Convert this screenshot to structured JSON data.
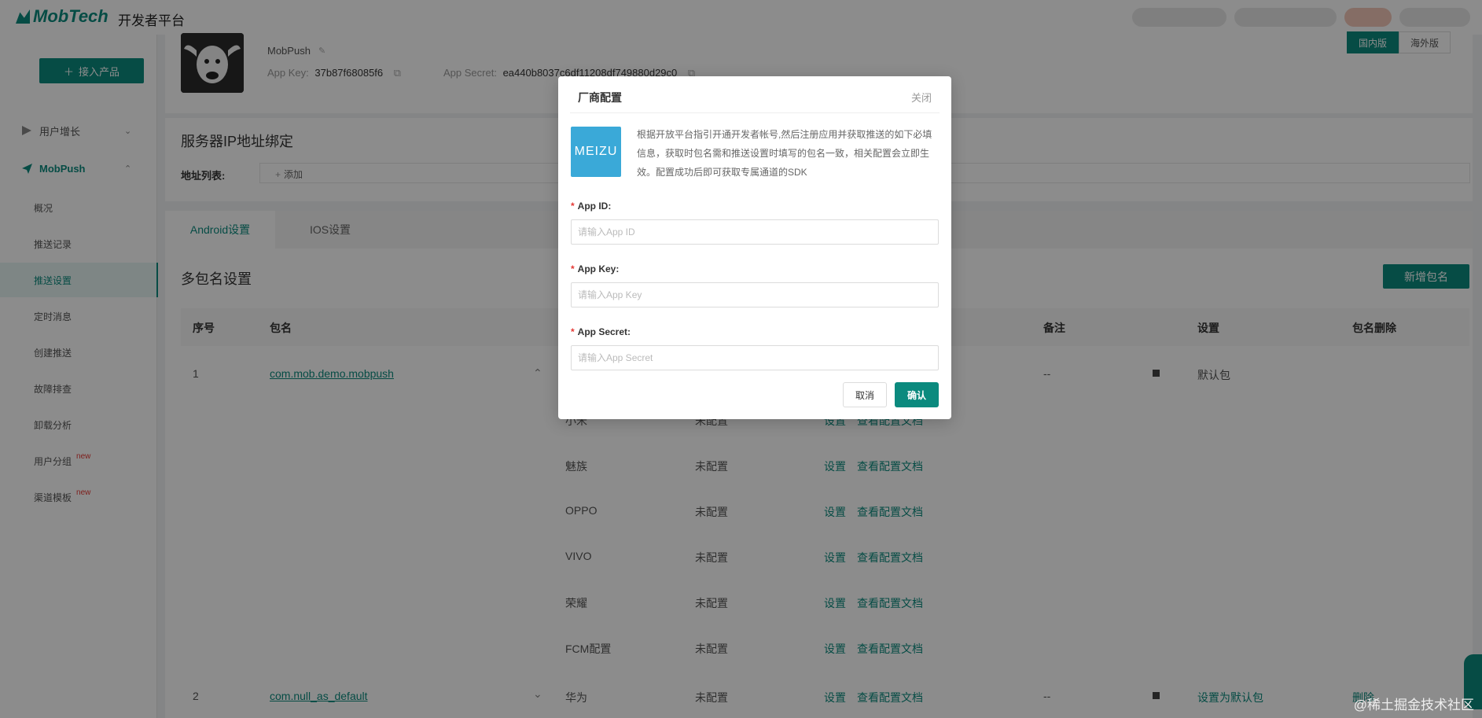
{
  "header": {
    "brand": "MobTech",
    "platform_name": "开发者平台"
  },
  "sidebar": {
    "access_button": "接入产品",
    "groups": [
      {
        "label": "用户增长"
      },
      {
        "label": "MobPush"
      }
    ],
    "items": [
      {
        "label": "概况"
      },
      {
        "label": "推送记录"
      },
      {
        "label": "推送设置"
      },
      {
        "label": "定时消息"
      },
      {
        "label": "创建推送"
      },
      {
        "label": "故障排查"
      },
      {
        "label": "卸载分析"
      },
      {
        "label": "用户分组",
        "badge": "new"
      },
      {
        "label": "渠道模板",
        "badge": "new"
      }
    ]
  },
  "app": {
    "name": "MobPush",
    "key_label": "App Key:",
    "key_value": "37b87f68085f6",
    "secret_label": "App Secret:",
    "secret_value": "ea440b8037c6df11208df749880d29c0"
  },
  "region_switch": {
    "domestic": "国内版",
    "overseas": "海外版"
  },
  "ip_binding": {
    "title": "服务器IP地址绑定",
    "list_label": "地址列表:",
    "add_label": "添加"
  },
  "tabs": [
    {
      "label": "Android设置"
    },
    {
      "label": "IOS设置"
    }
  ],
  "packages": {
    "title": "多包名设置",
    "add_button": "新增包名",
    "columns": {
      "index": "序号",
      "package": "包名",
      "note": "备注",
      "settings": "设置",
      "delete": "包名删除"
    },
    "rows": [
      {
        "index": "1",
        "package": "com.mob.demo.mobpush",
        "note": "--",
        "settings": "默认包",
        "delete": ""
      },
      {
        "index": "2",
        "package": "com.null_as_default",
        "note": "--",
        "settings": "设置为默认包",
        "delete": "删除"
      }
    ],
    "vendors": [
      {
        "name": "小米",
        "status": "未配置",
        "set": "设置",
        "doc": "查看配置文档"
      },
      {
        "name": "魅族",
        "status": "未配置",
        "set": "设置",
        "doc": "查看配置文档"
      },
      {
        "name": "OPPO",
        "status": "未配置",
        "set": "设置",
        "doc": "查看配置文档"
      },
      {
        "name": "VIVO",
        "status": "未配置",
        "set": "设置",
        "doc": "查看配置文档"
      },
      {
        "name": "荣耀",
        "status": "未配置",
        "set": "设置",
        "doc": "查看配置文档"
      },
      {
        "name": "FCM配置",
        "status": "未配置",
        "set": "设置",
        "doc": "查看配置文档"
      },
      {
        "name": "华为",
        "status": "未配置",
        "set": "设置",
        "doc": "查看配置文档"
      }
    ]
  },
  "modal": {
    "title": "厂商配置",
    "close": "关闭",
    "logo_text": "MEIZU",
    "description": "根据开放平台指引开通开发者帐号,然后注册应用并获取推送的如下必填信息，获取时包名需和推送设置时填写的包名一致，相关配置会立即生效。配置成功后即可获取专属通道的SDK",
    "fields": [
      {
        "label": "App ID:",
        "placeholder": "请输入App ID",
        "value": ""
      },
      {
        "label": "App Key:",
        "placeholder": "请输入App Key",
        "value": ""
      },
      {
        "label": "App Secret:",
        "placeholder": "请输入App Secret",
        "value": ""
      }
    ],
    "cancel": "取消",
    "confirm": "确认"
  },
  "watermark": "@稀土掘金技术社区",
  "colors": {
    "accent": "#0b8a7e",
    "meizu_blue": "#3aa9d8",
    "required": "#e53935"
  }
}
